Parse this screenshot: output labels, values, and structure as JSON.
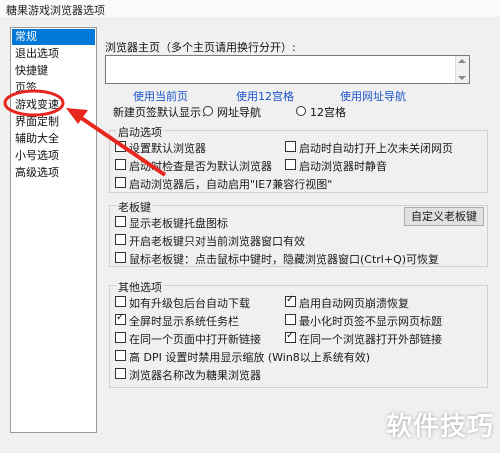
{
  "window": {
    "title": "糖果游戏浏览器选项"
  },
  "nav": {
    "items": [
      {
        "label": "常规",
        "selected": true
      },
      {
        "label": "退出选项"
      },
      {
        "label": "快捷键"
      },
      {
        "label": "页签"
      },
      {
        "label": "游戏变速"
      },
      {
        "label": "界面定制"
      },
      {
        "label": "辅助大全"
      },
      {
        "label": "小号选项"
      },
      {
        "label": "高级选项"
      }
    ]
  },
  "homepage": {
    "label": "浏览器主页（多个主页请用换行分开）:",
    "value": "",
    "links": [
      "使用当前页",
      "使用12宫格",
      "使用网址导航"
    ]
  },
  "newtab": {
    "label": "新建页签默认显示：",
    "options": [
      "网址导航",
      "12宫格"
    ]
  },
  "startup": {
    "title": "启动选项",
    "options": [
      {
        "label": "设置默认浏览器",
        "checked": false
      },
      {
        "label": "启动时自动打开上次未关闭网页",
        "checked": false
      },
      {
        "label": "启动时检查是否为默认浏览器",
        "checked": false
      },
      {
        "label": "启动浏览器时静音",
        "checked": false
      },
      {
        "label": "启动浏览器后，自动启用\"IE7兼容行视图\"",
        "checked": false
      }
    ]
  },
  "bosskey": {
    "title": "老板键",
    "button": "自定义老板键",
    "options": [
      {
        "label": "显示老板键托盘图标",
        "checked": false
      },
      {
        "label": "开启老板键只对当前浏览器窗口有效",
        "checked": false
      },
      {
        "label": "鼠标老板键：点击鼠标中键时，隐藏浏览器窗口(Ctrl+Q)可恢复",
        "checked": false
      }
    ]
  },
  "other": {
    "title": "其他选项",
    "options": [
      {
        "label": "如有升级包后台自动下载",
        "checked": false
      },
      {
        "label": "启用自动网页崩溃恢复",
        "checked": true
      },
      {
        "label": "全屏时显示系统任务栏",
        "checked": true
      },
      {
        "label": "最小化时页签不显示网页标题",
        "checked": false
      },
      {
        "label": "在同一个页面中打开新链接",
        "checked": false
      },
      {
        "label": "在同一个浏览器打开外部链接",
        "checked": true
      },
      {
        "label": "高 DPI 设置时禁用显示缩放 (Win8以上系统有效)",
        "checked": false
      },
      {
        "label": "浏览器名称改为糖果浏览器",
        "checked": false
      }
    ]
  },
  "annotation": {
    "color": "#e8271f"
  },
  "watermark": "软件技巧"
}
